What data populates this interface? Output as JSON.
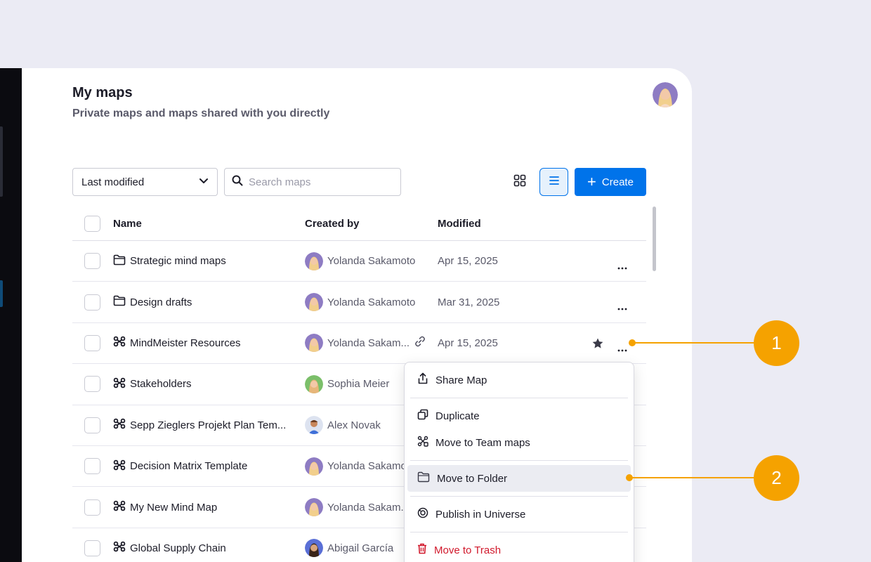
{
  "header": {
    "title": "My maps",
    "subtitle": "Private maps and maps shared with you directly"
  },
  "toolbar": {
    "sort_value": "Last modified",
    "search_placeholder": "Search maps",
    "create_label": "Create"
  },
  "table": {
    "columns": {
      "name": "Name",
      "created_by": "Created by",
      "modified": "Modified"
    },
    "rows": [
      {
        "icon": "folder-icon",
        "name": "Strategic mind maps",
        "created_by": "Yolanda Sakamoto",
        "modified": "Apr 15, 2025"
      },
      {
        "icon": "folder-icon",
        "name": "Design drafts",
        "created_by": "Yolanda Sakamoto",
        "modified": "Mar 31, 2025"
      },
      {
        "icon": "mindmap-icon",
        "name": "MindMeister Resources",
        "created_by": "Yolanda Sakam...",
        "modified": "Apr 15, 2025"
      },
      {
        "icon": "mindmap-icon",
        "name": "Stakeholders",
        "created_by": "Sophia Meier",
        "modified": ""
      },
      {
        "icon": "mindmap-icon",
        "name": "Sepp Zieglers Projekt Plan Tem...",
        "created_by": "Alex Novak",
        "modified": ""
      },
      {
        "icon": "mindmap-icon",
        "name": "Decision Matrix Template",
        "created_by": "Yolanda Sakamo",
        "modified": ""
      },
      {
        "icon": "mindmap-icon",
        "name": "My New Mind Map",
        "created_by": "Yolanda Sakam..",
        "modified": ""
      },
      {
        "icon": "mindmap-icon",
        "name": "Global Supply Chain",
        "created_by": "Abigail García",
        "modified": ""
      }
    ]
  },
  "context_menu": {
    "share": "Share Map",
    "duplicate": "Duplicate",
    "move_team": "Move to Team maps",
    "move_folder": "Move to Folder",
    "publish": "Publish in Universe",
    "trash": "Move to Trash"
  },
  "callouts": {
    "one": "1",
    "two": "2"
  },
  "colors": {
    "accent": "#0073ea",
    "callout": "#f5a200",
    "danger": "#d1192c"
  }
}
